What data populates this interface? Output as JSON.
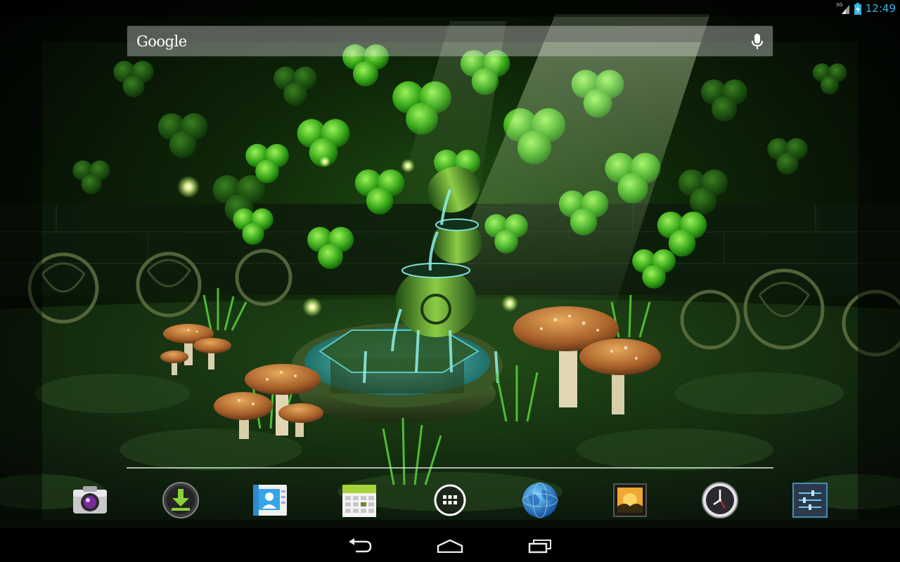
{
  "status_bar": {
    "network_label": "3G",
    "time": "12:49",
    "clock_color": "#33b5e5",
    "icons": [
      "signal-icon",
      "battery-charging-icon"
    ]
  },
  "search": {
    "logo_text": "Google",
    "icon": "mic-icon"
  },
  "wallpaper": {
    "description_icon": "celtic-garden-live-wallpaper"
  },
  "dock": {
    "items": [
      {
        "name": "camera-app",
        "icon": "camera-icon"
      },
      {
        "name": "downloads-app",
        "icon": "download-icon"
      },
      {
        "name": "contacts-app",
        "icon": "contacts-icon"
      },
      {
        "name": "calendar-app",
        "icon": "calendar-icon"
      },
      {
        "name": "all-apps",
        "icon": "app-drawer-icon"
      },
      {
        "name": "browser-app",
        "icon": "globe-icon"
      },
      {
        "name": "gallery-app",
        "icon": "gallery-icon"
      },
      {
        "name": "clock-app",
        "icon": "clock-icon"
      },
      {
        "name": "settings-app",
        "icon": "settings-icon"
      }
    ]
  },
  "nav_bar": {
    "buttons": [
      {
        "name": "back",
        "icon": "back-icon"
      },
      {
        "name": "home",
        "icon": "home-icon"
      },
      {
        "name": "recents",
        "icon": "recent-apps-icon"
      }
    ]
  },
  "colors": {
    "accent": "#33b5e5",
    "wallpaper_primary": "#2f8f1a",
    "navbar": "#000000"
  }
}
